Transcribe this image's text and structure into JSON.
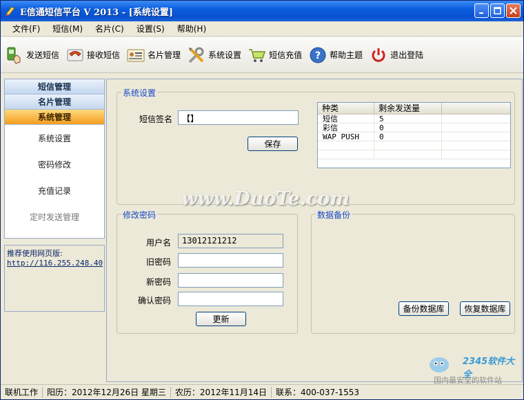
{
  "window": {
    "title": "E信通短信平台 V   2013 - [系统设置]"
  },
  "menu": [
    "文件(F)",
    "短信(M)",
    "名片(C)",
    "设置(S)",
    "帮助(H)"
  ],
  "toolbar": [
    {
      "label": "发送短信",
      "icon": "send-sms-icon"
    },
    {
      "label": "接收短信",
      "icon": "phone-receive-icon"
    },
    {
      "label": "名片管理",
      "icon": "business-card-icon"
    },
    {
      "label": "系统设置",
      "icon": "tools-icon"
    },
    {
      "label": "短信充值",
      "icon": "cart-icon"
    },
    {
      "label": "帮助主题",
      "icon": "help-icon"
    },
    {
      "label": "退出登陆",
      "icon": "power-icon"
    }
  ],
  "sidebar": {
    "headers": [
      "短信管理",
      "名片管理",
      "系统管理"
    ],
    "items": [
      "系统设置",
      "密码修改",
      "充值记录",
      "定时发送管理"
    ]
  },
  "recommend": {
    "title": "推荐使用网页版:",
    "link": "http://116.255.248.40"
  },
  "system_settings": {
    "legend": "系统设置",
    "signature_label": "短信签名",
    "signature_value": "【】",
    "save_button": "保存",
    "table": {
      "headers": [
        "种类",
        "剩余发送量"
      ],
      "rows": [
        [
          "短信",
          "5"
        ],
        [
          "彩信",
          "0"
        ],
        [
          "WAP PUSH",
          "0"
        ]
      ]
    }
  },
  "change_password": {
    "legend": "修改密码",
    "username_label": "用户名",
    "username_value": "13012121212",
    "old_password_label": "旧密码",
    "new_password_label": "新密码",
    "confirm_password_label": "确认密码",
    "update_button": "更新"
  },
  "backup": {
    "legend": "数据备份",
    "backup_button": "备份数据库",
    "restore_button": "恢复数据库"
  },
  "status": {
    "mode": "联机工作",
    "solar": "阳历：2012年12月26日 星期三",
    "lunar": "农历：2012年11月14日",
    "contact": "联系：400-037-1553"
  },
  "watermark": {
    "text": "www.DuoTe.com",
    "brand": "2345软件大全",
    "slogan": "国内最安全的软件站"
  }
}
